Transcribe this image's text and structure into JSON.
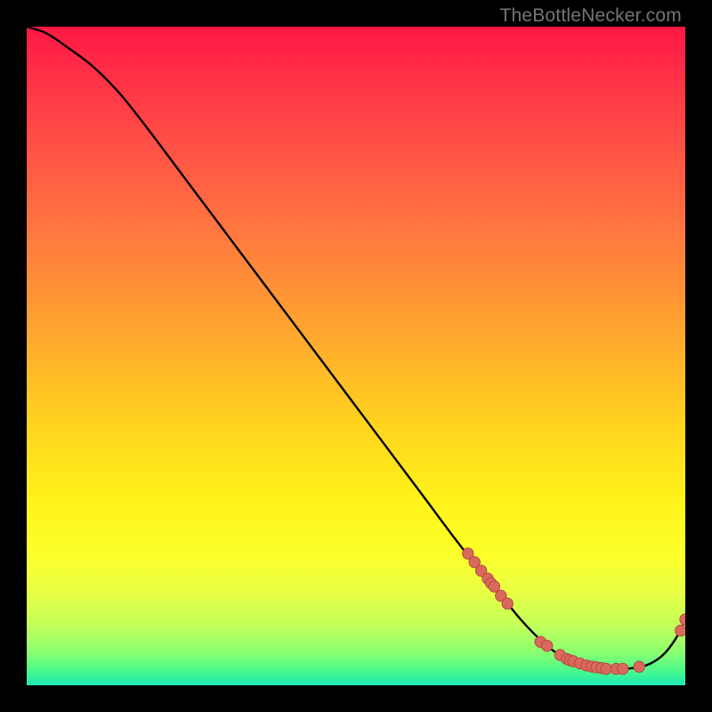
{
  "watermark": "TheBottleNecker.com",
  "chart_data": {
    "type": "line",
    "title": "",
    "xlabel": "",
    "ylabel": "",
    "xlim": [
      0,
      100
    ],
    "ylim": [
      0,
      100
    ],
    "gradient_stops": [
      {
        "pos": 0.0,
        "color": "#ff1744"
      },
      {
        "pos": 0.06,
        "color": "#ff2b46"
      },
      {
        "pos": 0.18,
        "color": "#ff5046"
      },
      {
        "pos": 0.32,
        "color": "#ff7a3f"
      },
      {
        "pos": 0.46,
        "color": "#ffa52f"
      },
      {
        "pos": 0.6,
        "color": "#ffd21e"
      },
      {
        "pos": 0.72,
        "color": "#fff31a"
      },
      {
        "pos": 0.8,
        "color": "#fcff2a"
      },
      {
        "pos": 0.86,
        "color": "#e8ff45"
      },
      {
        "pos": 0.91,
        "color": "#c2ff5a"
      },
      {
        "pos": 0.95,
        "color": "#8aff70"
      },
      {
        "pos": 0.98,
        "color": "#46f78e"
      },
      {
        "pos": 1.0,
        "color": "#1de9b6"
      }
    ],
    "series": [
      {
        "name": "bottleneck-curve",
        "x": [
          0,
          3,
          6,
          10,
          14,
          18,
          24,
          30,
          36,
          42,
          48,
          54,
          60,
          66,
          71,
          75,
          79,
          82,
          85,
          88,
          91,
          94,
          96.5,
          98.5,
          100
        ],
        "y": [
          100,
          99,
          97,
          94,
          90,
          85,
          77,
          69,
          61,
          53,
          45,
          37,
          29,
          21,
          15,
          10,
          6,
          4,
          3,
          2.5,
          2.5,
          3,
          4.5,
          7,
          10
        ]
      }
    ],
    "marker_clusters": [
      {
        "name": "cluster-drop",
        "points": [
          {
            "x": 67,
            "y": 20.0
          },
          {
            "x": 68,
            "y": 18.7
          },
          {
            "x": 69,
            "y": 17.4
          },
          {
            "x": 70,
            "y": 16.2
          },
          {
            "x": 70.5,
            "y": 15.5
          },
          {
            "x": 71,
            "y": 15.0
          },
          {
            "x": 72,
            "y": 13.6
          },
          {
            "x": 73,
            "y": 12.4
          }
        ]
      },
      {
        "name": "cluster-valley",
        "points": [
          {
            "x": 78,
            "y": 6.6
          },
          {
            "x": 79,
            "y": 6.0
          },
          {
            "x": 81,
            "y": 4.6
          },
          {
            "x": 82,
            "y": 4.0
          },
          {
            "x": 82.5,
            "y": 3.8
          },
          {
            "x": 83,
            "y": 3.65
          },
          {
            "x": 84,
            "y": 3.32
          },
          {
            "x": 85,
            "y": 3.0
          },
          {
            "x": 85.8,
            "y": 2.85
          },
          {
            "x": 86.5,
            "y": 2.74
          },
          {
            "x": 87.3,
            "y": 2.62
          },
          {
            "x": 88,
            "y": 2.5
          },
          {
            "x": 89.5,
            "y": 2.5
          },
          {
            "x": 90.5,
            "y": 2.5
          },
          {
            "x": 93,
            "y": 2.82
          }
        ]
      },
      {
        "name": "cluster-rise",
        "points": [
          {
            "x": 99.3,
            "y": 8.3
          },
          {
            "x": 100,
            "y": 10.0
          }
        ]
      }
    ],
    "colors": {
      "curve": "#000000",
      "marker_fill": "#d9695c",
      "marker_stroke": "#b84a3f"
    }
  }
}
